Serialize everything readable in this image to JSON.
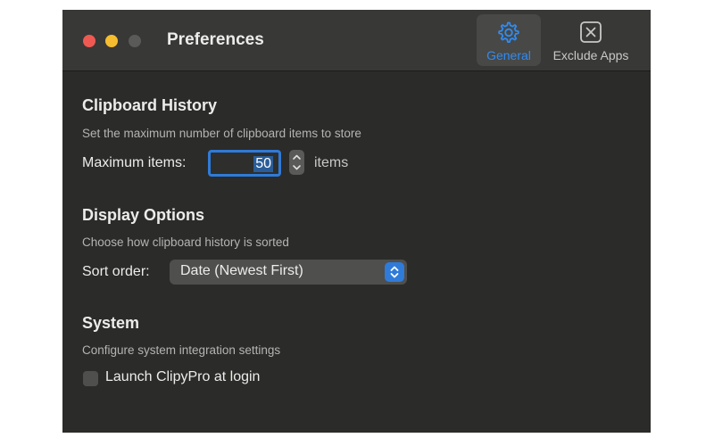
{
  "window": {
    "title": "Preferences"
  },
  "toolbar": {
    "tabs": [
      {
        "label": "General",
        "icon": "gear-icon",
        "active": true
      },
      {
        "label": "Exclude Apps",
        "icon": "x-square-icon",
        "active": false
      }
    ]
  },
  "clipboard_history": {
    "title": "Clipboard History",
    "description": "Set the maximum number of clipboard items to store",
    "max_items_label": "Maximum items:",
    "max_items_value": "50",
    "units_label": "items"
  },
  "display_options": {
    "title": "Display Options",
    "description": "Choose how clipboard history is sorted",
    "sort_label": "Sort order:",
    "sort_value": "Date (Newest First)"
  },
  "system": {
    "title": "System",
    "description": "Configure system integration settings",
    "launch_label": "Launch ClipyPro at login",
    "launch_checked": false
  },
  "colors": {
    "accent": "#2f7bd9",
    "window_bg": "#2b2b29",
    "titlebar_bg": "#383836",
    "close": "#ee5a52",
    "minimize": "#f5bd2f"
  }
}
